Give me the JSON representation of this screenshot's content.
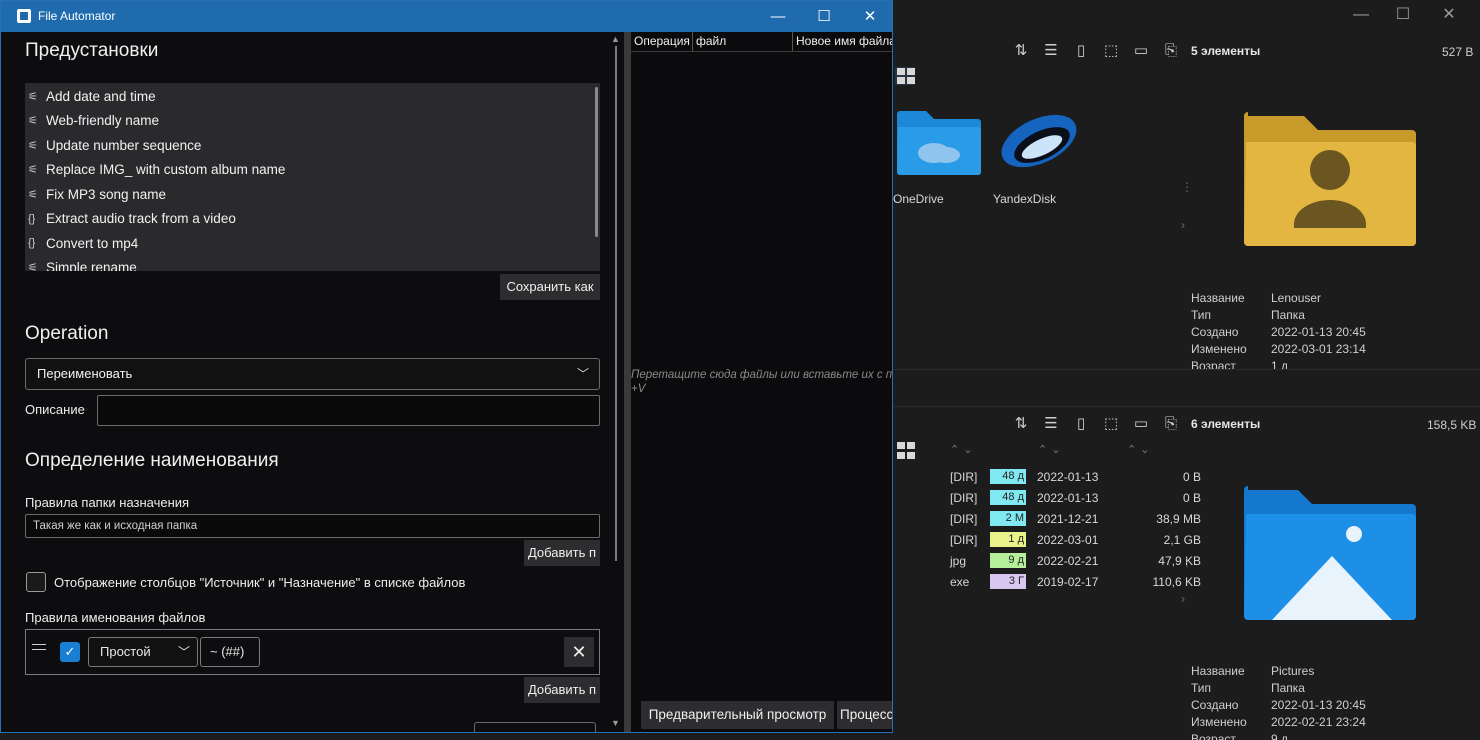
{
  "explorer": {
    "win_controls": {
      "minimize": "—",
      "maximize": "☐",
      "close": "✕"
    },
    "top_pane": {
      "count": "5 элементы",
      "size": "527 В",
      "items": [
        {
          "label": "OneDrive",
          "icon": "onedrive-folder-icon"
        },
        {
          "label": "YandexDisk",
          "icon": "yandex-disk-icon"
        }
      ],
      "details": [
        {
          "k": "Название",
          "v": "Lenouser"
        },
        {
          "k": "Тип",
          "v": "Папка"
        },
        {
          "k": "Создано",
          "v": "2022-01-13  20:45"
        },
        {
          "k": "Изменено",
          "v": "2022-03-01  23:14"
        },
        {
          "k": "Возраст",
          "v": "1 д"
        }
      ]
    },
    "bottom_pane": {
      "count": "6 элементы",
      "size": "158,5 KB",
      "rows": [
        {
          "ext": "[DIR]",
          "age": "48 д",
          "age_color": "#7fe8f0",
          "date": "2022-01-13",
          "size": "0 B"
        },
        {
          "ext": "[DIR]",
          "age": "48 д",
          "age_color": "#7fe8f0",
          "date": "2022-01-13",
          "size": "0 B"
        },
        {
          "ext": "[DIR]",
          "age": "2 М",
          "age_color": "#7fe8f0",
          "date": "2021-12-21",
          "size": "38,9 MB"
        },
        {
          "ext": "[DIR]",
          "age": "1 д",
          "age_color": "#eaf28a",
          "date": "2022-03-01",
          "size": "2,1 GB"
        },
        {
          "ext": "jpg",
          "age": "9 д",
          "age_color": "#b5ef9a",
          "date": "2022-02-21",
          "size": "47,9 KB"
        },
        {
          "ext": "exe",
          "age": "3 Г",
          "age_color": "#d9c7f2",
          "date": "2019-02-17",
          "size": "110,6 KB"
        }
      ],
      "details": [
        {
          "k": "Название",
          "v": "Pictures"
        },
        {
          "k": "Тип",
          "v": "Папка"
        },
        {
          "k": "Создано",
          "v": "2022-01-13  20:45"
        },
        {
          "k": "Изменено",
          "v": "2022-02-21  23:24"
        },
        {
          "k": "Возраст",
          "v": "9 д"
        }
      ]
    }
  },
  "automator": {
    "title": "File Automator",
    "win_controls": {
      "minimize": "—",
      "maximize": "☐",
      "close": "✕"
    },
    "presets_heading": "Предустановки",
    "presets": [
      {
        "icon": "script-icon",
        "glyph": "⚟",
        "label": "Add date and time"
      },
      {
        "icon": "script-icon",
        "glyph": "⚟",
        "label": "Web-friendly name"
      },
      {
        "icon": "script-icon",
        "glyph": "⚟",
        "label": "Update number sequence"
      },
      {
        "icon": "script-icon",
        "glyph": "⚟",
        "label": "Replace IMG_ with custom album name"
      },
      {
        "icon": "script-icon",
        "glyph": "⚟",
        "label": "Fix MP3 song name"
      },
      {
        "icon": "braces-icon",
        "glyph": "{}",
        "label": "Extract audio track from a video"
      },
      {
        "icon": "braces-icon",
        "glyph": "{}",
        "label": "Convert to mp4"
      },
      {
        "icon": "script-icon",
        "glyph": "⚟",
        "label": "Simple rename"
      }
    ],
    "save_as_label": "Сохранить как",
    "operation_heading": "Operation",
    "operation_value": "Переименовать",
    "description_label": "Описание",
    "description_value": "",
    "naming_heading": "Определение наименования",
    "dest_folder_label": "Правила папки назначения",
    "dest_folder_value": "Такая же как и исходная папка",
    "add_label": "Добавить п",
    "show_columns_label": "Отображение столбцов \"Источник\" и \"Назначение\" в списке файлов",
    "file_naming_label": "Правила именования файлов",
    "rule": {
      "mode": "Простой",
      "pattern": "~ (##)",
      "enabled": true
    },
    "add_label_2": "Добавить п",
    "columns": [
      "Операция",
      "файл",
      "Новое имя файла"
    ],
    "drop_hint": "Перетащите сюда файлы или вставьте их с п",
    "drop_hint_2": "+V",
    "preview_label": "Предварительный просмотр",
    "process_label": "Процесс"
  }
}
